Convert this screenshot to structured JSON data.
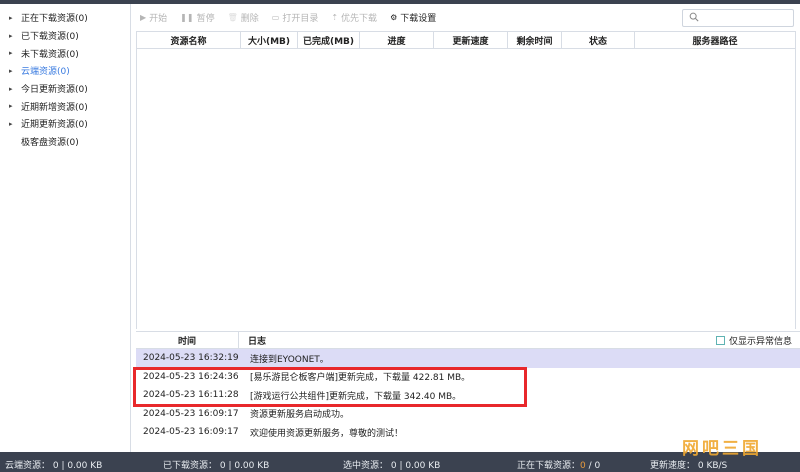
{
  "sidebar": {
    "items": [
      {
        "label": "正在下载资源(0)",
        "arrow": "▸",
        "active": false
      },
      {
        "label": "已下载资源(0)",
        "arrow": "▸",
        "active": false
      },
      {
        "label": "未下载资源(0)",
        "arrow": "▸",
        "active": false
      },
      {
        "label": "云端资源(0)",
        "arrow": "▸",
        "active": true
      },
      {
        "label": "今日更新资源(0)",
        "arrow": "▸",
        "active": false
      },
      {
        "label": "近期新增资源(0)",
        "arrow": "▸",
        "active": false
      },
      {
        "label": "近期更新资源(0)",
        "arrow": "▸",
        "active": false
      },
      {
        "label": "极客盘资源(0)",
        "arrow": "",
        "active": false
      }
    ]
  },
  "toolbar": {
    "start": {
      "icon": "▶",
      "label": "开始"
    },
    "pause": {
      "icon": "❚❚",
      "label": "暂停"
    },
    "delete": {
      "icon": "🗑",
      "label": "删除"
    },
    "open_dir": {
      "icon": "▭",
      "label": "打开目录"
    },
    "priority": {
      "icon": "⇡",
      "label": "优先下载"
    },
    "settings": {
      "icon": "⚙",
      "label": "下载设置"
    }
  },
  "table": {
    "columns": [
      "资源名称",
      "大小(MB)",
      "已完成(MB)",
      "进度",
      "更新速度",
      "剩余时间",
      "状态",
      "服务器路径"
    ]
  },
  "log": {
    "header_time": "时间",
    "header_log": "日志",
    "only_errors_label": "仅显示异常信息",
    "rows": [
      {
        "time": "2024-05-23 16:32:19",
        "message": "连接到EYOONET。",
        "selected": true
      },
      {
        "time": "2024-05-23 16:24:36",
        "message": "[易乐游昆仑板客户端]更新完成，下载量 422.81 MB。",
        "selected": false
      },
      {
        "time": "2024-05-23 16:11:28",
        "message": "[游戏运行公共组件]更新完成，下载量 342.40 MB。",
        "selected": false
      },
      {
        "time": "2024-05-23 16:09:17",
        "message": "资源更新服务启动成功。",
        "selected": false
      },
      {
        "time": "2024-05-23 16:09:17",
        "message": "欢迎使用资源更新服务，尊敬的测试！",
        "selected": false
      }
    ]
  },
  "status": {
    "cloud": "云端资源： 0 | 0.00 KB",
    "downloaded": "已下载资源： 0 | 0.00 KB",
    "selected": "选中资源： 0 | 0.00 KB",
    "downloading_label": "正在下载资源：",
    "downloading_a": "0",
    "downloading_b": " / 0",
    "speed": "更新速度： 0 KB/S"
  },
  "watermark": "网吧三国",
  "colors": {
    "accent": "#3a7be0",
    "highlight": "#e8282b",
    "statusbar": "#3b4250",
    "selected_row": "#dcdcf6"
  }
}
